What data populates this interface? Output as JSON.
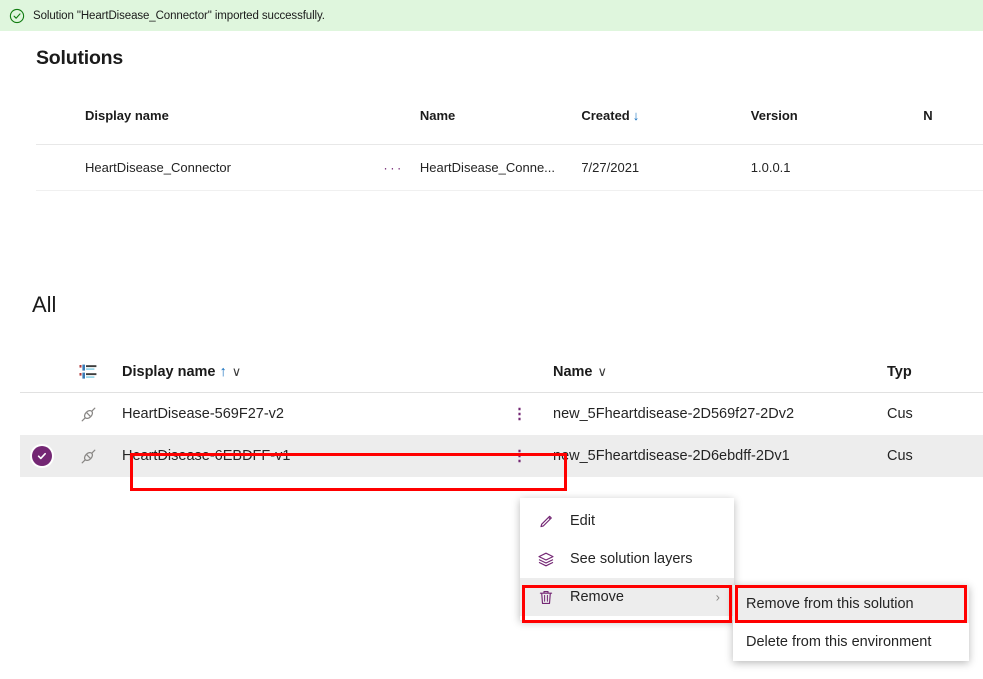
{
  "banner": {
    "icon": "circle-check-icon",
    "message": "Solution \"HeartDisease_Connector\" imported successfully.",
    "background": "#dff6dd",
    "icon_color": "#107c10"
  },
  "solutions": {
    "title": "Solutions",
    "columns": [
      "Display name",
      "Name",
      "Created",
      "Version",
      "N"
    ],
    "sort": {
      "column": "Created",
      "direction": "descending",
      "glyph": "↓",
      "color": "#0f6cbd"
    },
    "rows": [
      {
        "display_name": "HeartDisease_Connector",
        "name": "HeartDisease_Conne...",
        "created": "7/27/2021",
        "version": "1.0.0.1",
        "overflow": "···"
      }
    ]
  },
  "all": {
    "title": "All",
    "view_icon": "list-view-icon",
    "columns": {
      "display_name": "Display name",
      "name": "Name",
      "type": "Typ"
    },
    "sort": {
      "column": "Display name",
      "direction": "ascending",
      "glyph": "↑",
      "color": "#0f6cbd"
    },
    "chevron": "∨",
    "rows": [
      {
        "selected": false,
        "icon": "connector-plug-icon",
        "display_name": "HeartDisease-569F27-v2",
        "name": "new_5Fheartdisease-2D569f27-2Dv2",
        "type": "Cus",
        "overflow": "⋮"
      },
      {
        "selected": true,
        "icon": "connector-plug-icon",
        "display_name": "HeartDisease-6EBDFF-v1",
        "name": "new_5Fheartdisease-2D6ebdff-2Dv1",
        "type": "Cus",
        "overflow": "⋮"
      }
    ]
  },
  "context_menu": {
    "items": [
      {
        "label": "Edit",
        "icon": "pencil-icon",
        "highlighted": false,
        "has_submenu": false
      },
      {
        "label": "See solution layers",
        "icon": "layers-icon",
        "highlighted": false,
        "has_submenu": false
      },
      {
        "label": "Remove",
        "icon": "trash-icon",
        "highlighted": true,
        "has_submenu": true,
        "submenu_glyph": "›"
      }
    ]
  },
  "submenu": {
    "items": [
      {
        "label": "Remove from this solution",
        "highlighted": true
      },
      {
        "label": "Delete from this environment",
        "highlighted": false
      }
    ]
  },
  "annotations": {
    "highlight_color": "#ff0000",
    "boxes": [
      "selected-row-display-name",
      "remove-menu-item",
      "remove-from-this-solution-item"
    ]
  },
  "theme": {
    "accent_purple": "#742774",
    "link_blue": "#0f6cbd",
    "selected_row_bg": "#ededed"
  }
}
